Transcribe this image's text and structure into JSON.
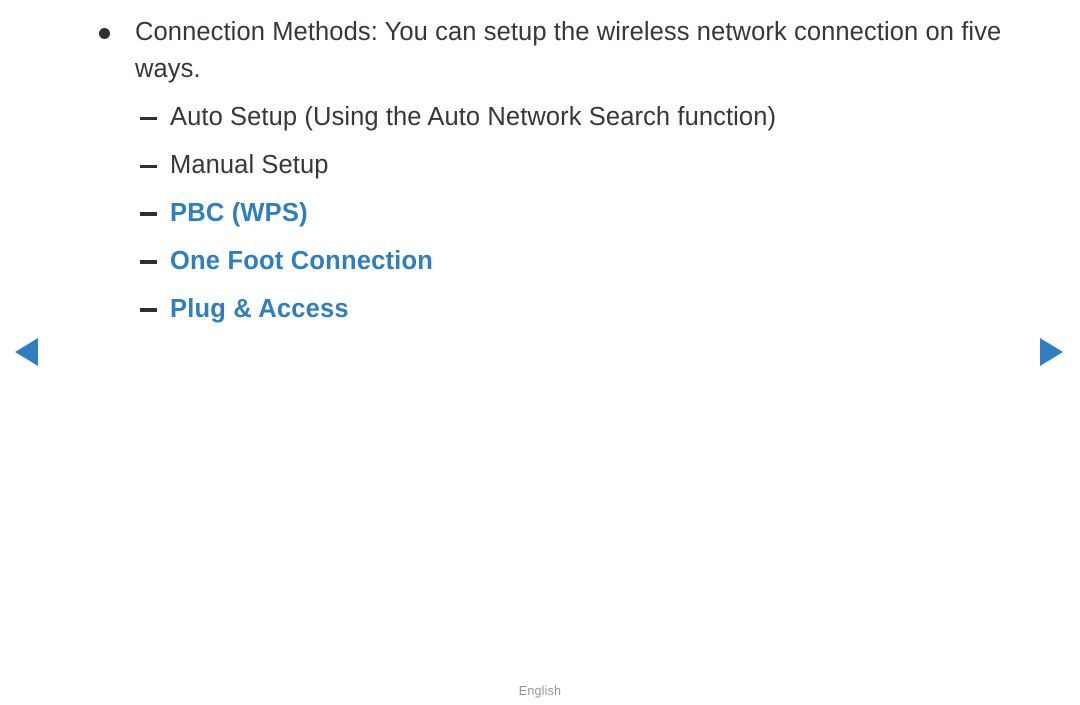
{
  "colors": {
    "background": "#ffffff",
    "body_text": "#3b3539",
    "highlight": "#2f7ec0",
    "marker": "#332e31",
    "footer_text": "#9b9396",
    "arrow": "#2f7ec0"
  },
  "content": {
    "bullet": {
      "marker": "bullet-dot",
      "text": "Connection Methods: You can setup the wireless network connection on five ways."
    },
    "sub_items": [
      {
        "marker": "dash",
        "text": "Auto Setup (Using the Auto Network Search function)",
        "highlighted": false
      },
      {
        "marker": "dash",
        "text": "Manual Setup",
        "highlighted": false
      },
      {
        "marker": "dash",
        "text": "PBC (WPS)",
        "highlighted": true
      },
      {
        "marker": "dash",
        "text": "One Foot Connection",
        "highlighted": true
      },
      {
        "marker": "dash",
        "text": "Plug & Access",
        "highlighted": true
      }
    ]
  },
  "navigation": {
    "prev": {
      "icon": "triangle-left-icon",
      "label": "Previous page"
    },
    "next": {
      "icon": "triangle-right-icon",
      "label": "Next page"
    }
  },
  "footer": {
    "language": "English"
  }
}
